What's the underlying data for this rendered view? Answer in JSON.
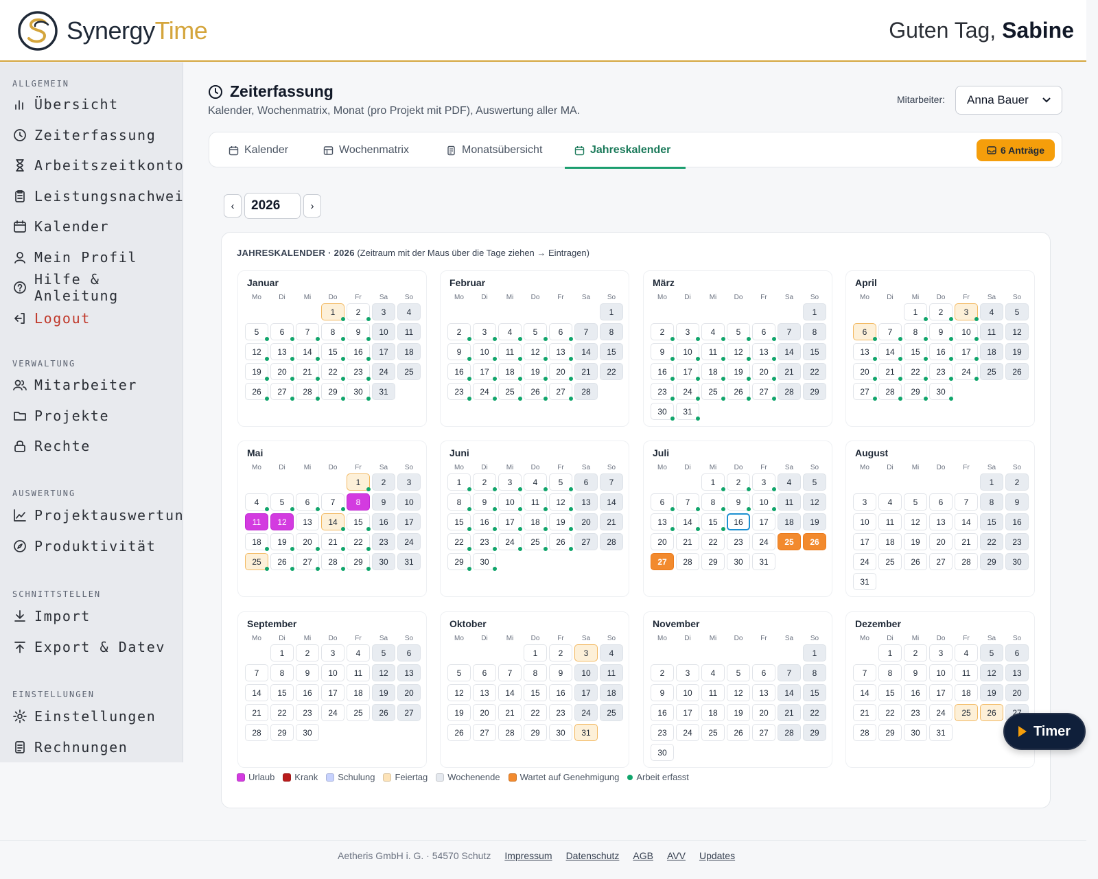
{
  "brand": {
    "name_part1": "Synergy",
    "name_part2": "Time",
    "accent": "#d4a53c"
  },
  "greeting": {
    "prefix": "Guten Tag, ",
    "name": "Sabine"
  },
  "sidebar": {
    "sections": [
      {
        "title": "ALLGEMEIN",
        "items": [
          {
            "label": "Übersicht",
            "icon": "bar-chart-icon"
          },
          {
            "label": "Zeiterfassung",
            "icon": "clock-icon"
          },
          {
            "label": "Arbeitszeitkonto",
            "icon": "hourglass-icon"
          },
          {
            "label": "Leistungsnachweis",
            "icon": "clipboard-icon"
          },
          {
            "label": "Kalender",
            "icon": "calendar-icon"
          },
          {
            "label": "Mein Profil",
            "icon": "user-icon"
          },
          {
            "label": "Hilfe & Anleitung",
            "icon": "help-icon"
          },
          {
            "label": "Logout",
            "icon": "logout-icon"
          }
        ]
      },
      {
        "title": "VERWALTUNG",
        "items": [
          {
            "label": "Mitarbeiter",
            "icon": "users-icon"
          },
          {
            "label": "Projekte",
            "icon": "folder-icon"
          },
          {
            "label": "Rechte",
            "icon": "lock-icon"
          }
        ]
      },
      {
        "title": "AUSWERTUNG",
        "items": [
          {
            "label": "Projektauswertung",
            "icon": "line-chart-icon"
          },
          {
            "label": "Produktivität",
            "icon": "compass-icon"
          }
        ]
      },
      {
        "title": "SCHNITTSTELLEN",
        "items": [
          {
            "label": "Import",
            "icon": "download-icon"
          },
          {
            "label": "Export & Datev",
            "icon": "upload-icon"
          }
        ]
      },
      {
        "title": "EINSTELLUNGEN",
        "items": [
          {
            "label": "Einstellungen",
            "icon": "gear-icon"
          },
          {
            "label": "Rechnungen",
            "icon": "document-icon"
          }
        ]
      }
    ]
  },
  "page": {
    "title": "Zeiterfassung",
    "subtitle": "Kalender, Wochenmatrix, Monat (pro Projekt mit PDF), Auswertung aller MA.",
    "employee_label": "Mitarbeiter:",
    "employee_selected": "Anna Bauer"
  },
  "tabs": [
    {
      "label": "Kalender",
      "active": false
    },
    {
      "label": "Wochenmatrix",
      "active": false
    },
    {
      "label": "Monatsübersicht",
      "active": false
    },
    {
      "label": "Jahreskalender",
      "active": true
    }
  ],
  "antraege_label": "6 Anträge",
  "year_nav": {
    "prev": "‹",
    "year": "2026",
    "next": "›"
  },
  "calendar": {
    "heading_bold": "JAHRESKALENDER · 2026",
    "heading_rest": " (Zeitraum mit der Maus über die Tage ziehen → Eintragen)",
    "weekdays": [
      "Mo",
      "Di",
      "Mi",
      "Do",
      "Fr",
      "Sa",
      "So"
    ],
    "months": [
      {
        "name": "Januar",
        "offset": 3,
        "days": 31,
        "holidays": [
          1
        ],
        "work": [
          1,
          2,
          5,
          6,
          7,
          8,
          9,
          12,
          13,
          14,
          15,
          16,
          19,
          20,
          21,
          22,
          23,
          26,
          27,
          28,
          29,
          30
        ]
      },
      {
        "name": "Februar",
        "offset": 6,
        "days": 28,
        "work": [
          2,
          3,
          4,
          5,
          6,
          9,
          10,
          11,
          12,
          13,
          16,
          17,
          18,
          19,
          20,
          23,
          24,
          25,
          26,
          27
        ]
      },
      {
        "name": "März",
        "offset": 6,
        "days": 31,
        "work": [
          2,
          3,
          4,
          5,
          6,
          9,
          10,
          11,
          12,
          13,
          16,
          17,
          18,
          19,
          20,
          23,
          24,
          25,
          26,
          27,
          30,
          31
        ]
      },
      {
        "name": "April",
        "offset": 2,
        "days": 30,
        "holidays": [
          3,
          6
        ],
        "work": [
          1,
          2,
          3,
          6,
          7,
          8,
          9,
          10,
          13,
          14,
          15,
          16,
          17,
          20,
          21,
          22,
          23,
          24,
          27,
          28,
          29,
          30
        ]
      },
      {
        "name": "Mai",
        "offset": 4,
        "days": 31,
        "holidays": [
          1,
          14,
          25
        ],
        "vacation": [
          8,
          11,
          12
        ],
        "work": [
          1,
          4,
          5,
          6,
          7,
          14,
          15,
          18,
          19,
          20,
          21,
          22,
          25,
          26,
          27,
          28,
          29
        ]
      },
      {
        "name": "Juni",
        "offset": 0,
        "days": 30,
        "work": [
          1,
          2,
          3,
          4,
          5,
          8,
          9,
          10,
          11,
          12,
          15,
          16,
          17,
          18,
          19,
          22,
          23,
          24,
          25,
          26,
          29,
          30
        ]
      },
      {
        "name": "Juli",
        "offset": 2,
        "days": 31,
        "pending": [
          25,
          26,
          27
        ],
        "today": 16,
        "work": [
          1,
          2,
          3,
          6,
          7,
          8,
          9,
          10,
          13,
          14,
          15
        ]
      },
      {
        "name": "August",
        "offset": 5,
        "days": 31
      },
      {
        "name": "September",
        "offset": 1,
        "days": 30
      },
      {
        "name": "Oktober",
        "offset": 3,
        "days": 31,
        "holidays": [
          3,
          31
        ]
      },
      {
        "name": "November",
        "offset": 6,
        "days": 30
      },
      {
        "name": "Dezember",
        "offset": 1,
        "days": 31,
        "holidays": [
          25,
          26
        ]
      }
    ]
  },
  "legend": [
    {
      "label": "Urlaub",
      "color": "#d33be0"
    },
    {
      "label": "Krank",
      "color": "#b91c1c"
    },
    {
      "label": "Schulung",
      "color": "#c7d2fe"
    },
    {
      "label": "Feiertag",
      "color": "#fde3b8"
    },
    {
      "label": "Wochenende",
      "color": "#e5e9ef"
    },
    {
      "label": "Wartet auf Genehmigung",
      "color": "#f28a2e"
    },
    {
      "label": "Arbeit erfasst",
      "color": "#10a56b"
    }
  ],
  "timer_label": "Timer",
  "footer": {
    "company": "Aetheris GmbH i. G. · 54570 Schutz",
    "links": [
      "Impressum",
      "Datenschutz",
      "AGB",
      "AVV",
      "Updates"
    ]
  }
}
